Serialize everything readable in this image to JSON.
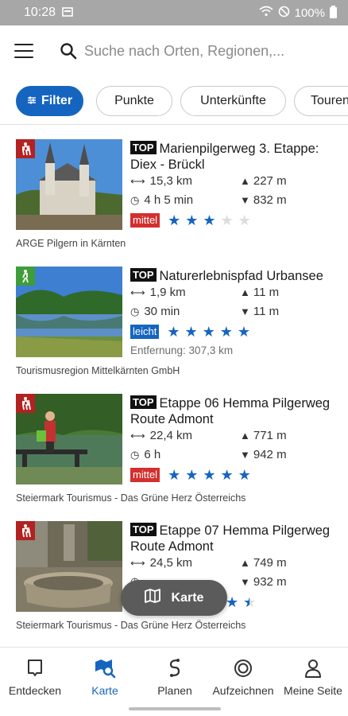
{
  "status_bar": {
    "time": "10:28",
    "battery": "100%"
  },
  "search": {
    "placeholder": "Suche nach Orten, Regionen,..."
  },
  "chips": [
    {
      "label": "Filter"
    },
    {
      "label": "Punkte"
    },
    {
      "label": "Unterkünfte"
    },
    {
      "label": "Touren"
    }
  ],
  "tours": [
    {
      "badge": "TOP",
      "title": "Marienpilgerweg 3. Etappe: Diex - Brückl",
      "category": "hiking",
      "distance": "15,3 km",
      "duration": "4 h 5 min",
      "ascent": "227 m",
      "descent": "832 m",
      "difficulty": "mittel",
      "rating": 3,
      "source": "ARGE Pilgern in Kärnten"
    },
    {
      "badge": "TOP",
      "title": "Naturerlebnispfad Urbansee",
      "category": "walking",
      "distance": "1,9 km",
      "duration": "30 min",
      "ascent": "11 m",
      "descent": "11 m",
      "difficulty": "leicht",
      "rating": 5,
      "distance_from_here": "Entfernung: 307,3 km",
      "source": "Tourismusregion Mittelkärnten GmbH"
    },
    {
      "badge": "TOP",
      "title": "Etappe 06 Hemma Pilgerweg Route Admont",
      "category": "hiking",
      "distance": "22,4 km",
      "duration": "6 h",
      "ascent": "771 m",
      "descent": "942 m",
      "difficulty": "mittel",
      "rating": 5,
      "source": "Steiermark Tourismus - Das Grüne Herz Österreichs"
    },
    {
      "badge": "TOP",
      "title": "Etappe 07 Hemma Pilgerweg Route Admont",
      "category": "hiking",
      "distance": "24,5 km",
      "ascent": "749 m",
      "descent": "932 m",
      "rating": 4.5,
      "source": "Steiermark Tourismus - Das Grüne Herz Österreichs"
    }
  ],
  "map_button": {
    "label": "Karte"
  },
  "bottom_nav": [
    {
      "label": "Entdecken",
      "icon": "bookmark-icon"
    },
    {
      "label": "Karte",
      "icon": "map-search-icon",
      "active": true
    },
    {
      "label": "Planen",
      "icon": "route-icon"
    },
    {
      "label": "Aufzeichnen",
      "icon": "record-icon"
    },
    {
      "label": "Meine Seite",
      "icon": "user-icon"
    }
  ],
  "colors": {
    "accent": "#1565c0",
    "mittel": "#d32f2f",
    "leicht": "#1565c0",
    "hiking": "#b32121",
    "walking": "#3f9d3a"
  }
}
